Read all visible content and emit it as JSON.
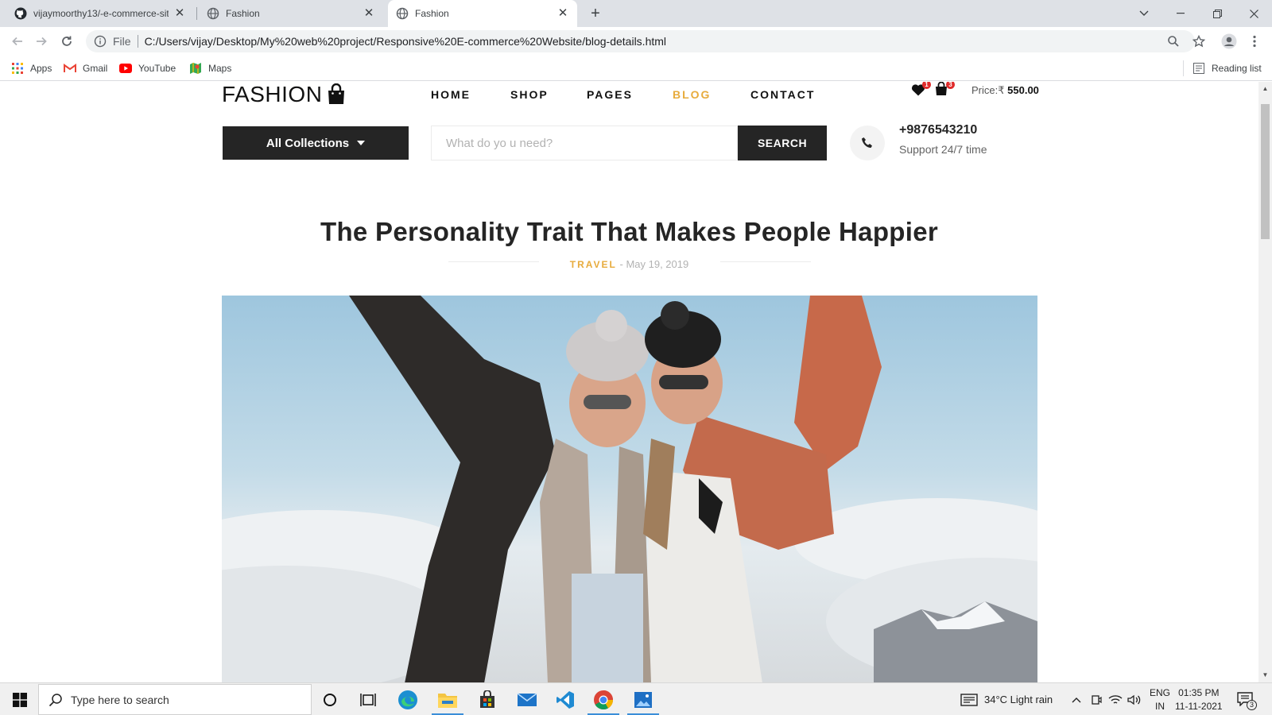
{
  "browser": {
    "tabs": [
      {
        "label": "vijaymoorthy13/-e-commerce-sit",
        "icon": "github-icon",
        "active": false
      },
      {
        "label": "Fashion",
        "icon": "globe-icon",
        "active": false
      },
      {
        "label": "Fashion",
        "icon": "globe-icon",
        "active": true
      }
    ],
    "address": {
      "scheme_label": "File",
      "url": "C:/Users/vijay/Desktop/My%20web%20project/Responsive%20E-commerce%20Website/blog-details.html"
    },
    "bookmarks": [
      {
        "label": "Apps",
        "icon": "apps-grid-icon"
      },
      {
        "label": "Gmail",
        "icon": "gmail-icon"
      },
      {
        "label": "YouTube",
        "icon": "youtube-icon"
      },
      {
        "label": "Maps",
        "icon": "maps-icon"
      }
    ],
    "reading_list": "Reading list"
  },
  "site": {
    "logo": "FASHION",
    "nav": [
      {
        "label": "HOME",
        "active": false
      },
      {
        "label": "SHOP",
        "active": false
      },
      {
        "label": "PAGES",
        "active": false
      },
      {
        "label": "BLOG",
        "active": true
      },
      {
        "label": "CONTACT",
        "active": false
      }
    ],
    "wishlist_count": "1",
    "cart_count": "3",
    "price_label": "Price:₹",
    "price_value": "550.00",
    "collections_label": "All Collections",
    "search_placeholder": "What do yo u need?",
    "search_button": "SEARCH",
    "phone": "+9876543210",
    "support": "Support 24/7 time",
    "accent_color": "#e7ab3c"
  },
  "post": {
    "title": "The Personality Trait That Makes People Happier",
    "category": "TRAVEL",
    "date": "- May 19, 2019"
  },
  "taskbar": {
    "search_placeholder": "Type here to search",
    "weather": "34°C  Light rain",
    "lang_top": "ENG",
    "lang_bottom": "IN",
    "time": "01:35 PM",
    "date": "11-11-2021",
    "notifications": "3"
  }
}
